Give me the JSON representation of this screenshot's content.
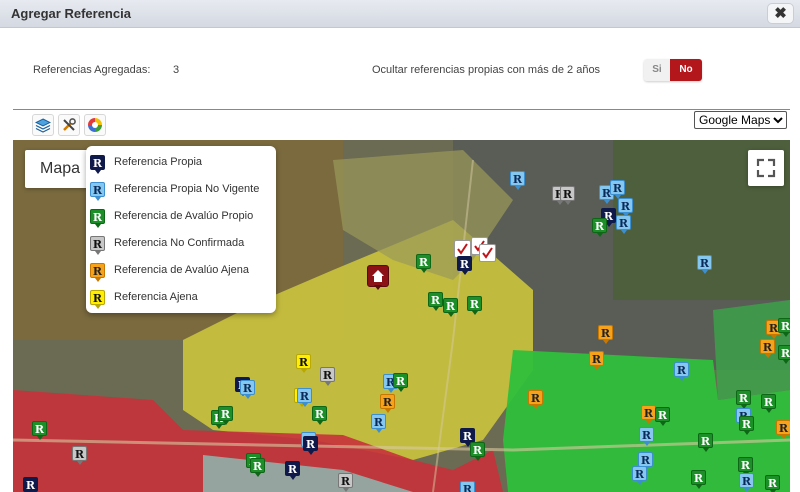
{
  "dialog": {
    "title": "Agregar Referencia",
    "close_icon": "✖"
  },
  "summary": {
    "refs_label": "Referencias Agregadas:",
    "refs_count": "3",
    "hide_label": "Ocultar referencias propias con más de 2 años",
    "toggle": {
      "yes": "Si",
      "no": "No",
      "selected": "No"
    }
  },
  "toolbar": {
    "tools": [
      "layers-icon",
      "tools-icon",
      "color-wheel-icon"
    ]
  },
  "map_type": {
    "selected": "Google Maps",
    "options": [
      "Google Maps"
    ]
  },
  "map": {
    "mapa_label": "Mapa",
    "legend": [
      {
        "label": "Referencia Propia",
        "color": "navy"
      },
      {
        "label": "Referencia Propia No Vigente",
        "color": "lightblue"
      },
      {
        "label": "Referencia de Avalúo Propio",
        "color": "green"
      },
      {
        "label": "Referencia No Confirmada",
        "color": "gray"
      },
      {
        "label": "Referencia de Avalúo Ajena",
        "color": "orange"
      },
      {
        "label": "Referencia Ajena",
        "color": "yellow"
      }
    ],
    "marker_letter": "R",
    "colors": {
      "navy": "#101a4a",
      "lightblue": "#86c7ef",
      "green": "#1c8f28",
      "gray": "#c7c7c7",
      "orange": "#f6a21a",
      "yellow": "#ffee00",
      "toggle_no": "#b3161b"
    }
  }
}
